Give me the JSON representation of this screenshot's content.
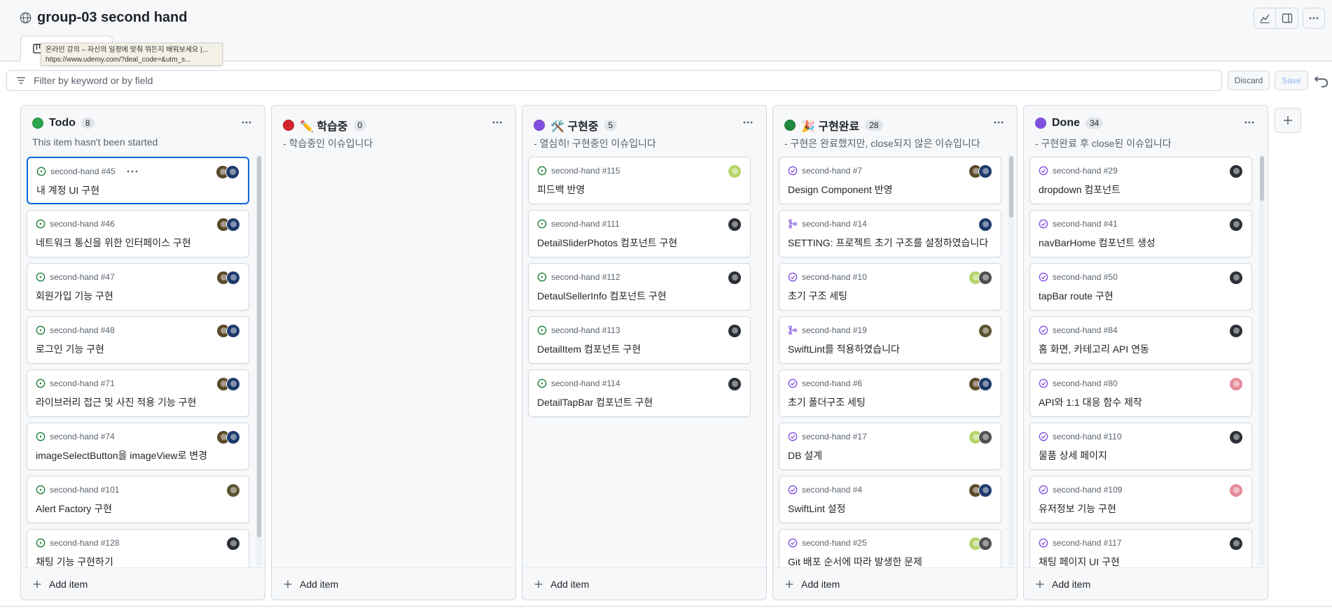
{
  "header": {
    "title": "group-03 second hand",
    "icons": [
      "globe-icon",
      "insights-icon",
      "panel-icon",
      "kebab-icon"
    ]
  },
  "view_tab": {
    "icon": "board-icon"
  },
  "tooltip": {
    "line1": "온라인 강의 – 자신의 일정에 맞춰 뭐든지 배워보세요 |...",
    "line2": "https://www.udemy.com/?deal_code=&utm_s..."
  },
  "filter": {
    "placeholder": "Filter by keyword or by field",
    "discard_label": "Discard",
    "save_label": "Save"
  },
  "colors": {
    "green": "#1f883d",
    "red": "#cf222e",
    "purple": "#8250df",
    "blue": "#0969da",
    "open": "#1a7f37",
    "done": "#8250df"
  },
  "columns": [
    {
      "name": "Todo",
      "count": "8",
      "dot": "#2da44e",
      "description": "This item hasn't been started",
      "add_label": "Add item",
      "scroll": {
        "thumb_top": 0,
        "thumb_frac": 0.93
      },
      "cards": [
        {
          "repo": "second-hand #45",
          "title": "내 계정 UI 구현",
          "state": "open",
          "selected": true,
          "avatars": [
            "#5a4a2a",
            "#1e3a6b"
          ]
        },
        {
          "repo": "second-hand #46",
          "title": "네트워크 통신을 위한 인터페이스 구현",
          "state": "open",
          "avatars": [
            "#5a4a2a",
            "#1e3a6b"
          ]
        },
        {
          "repo": "second-hand #47",
          "title": "회원가입 기능 구현",
          "state": "open",
          "avatars": [
            "#5a4a2a",
            "#1e3a6b"
          ]
        },
        {
          "repo": "second-hand #48",
          "title": "로그인 기능 구현",
          "state": "open",
          "avatars": [
            "#5a4a2a",
            "#1e3a6b"
          ]
        },
        {
          "repo": "second-hand #71",
          "title": "라이브러리 접근 및 사진 적용 기능 구현",
          "state": "open",
          "avatars": [
            "#5a4a2a",
            "#1e3a6b"
          ]
        },
        {
          "repo": "second-hand #74",
          "title": "imageSelectButton을 imageView로 변경",
          "state": "open",
          "avatars": [
            "#5a4a2a",
            "#1e3a6b"
          ]
        },
        {
          "repo": "second-hand #101",
          "title": "Alert Factory 구현",
          "state": "open",
          "avatars": [
            "#5b5432"
          ]
        },
        {
          "repo": "second-hand #128",
          "title": "채팅 기능 구현하기",
          "state": "open",
          "avatars": [
            "#2b2f36"
          ]
        }
      ]
    },
    {
      "name": "✏️ 학습중",
      "count": "0",
      "dot": "#d1242f",
      "description": "- 학습중인 이슈입니다",
      "add_label": "Add item",
      "cards": []
    },
    {
      "name": "🛠️ 구현중",
      "count": "5",
      "dot": "#8250df",
      "description": "- 열심히! 구현중인 이슈입니다",
      "add_label": "Add item",
      "cards": [
        {
          "repo": "second-hand #115",
          "title": "피드백 반영",
          "state": "open",
          "avatars": [
            "#b6d46a"
          ]
        },
        {
          "repo": "second-hand #111",
          "title": "DetailSliderPhotos 컴포넌트 구현",
          "state": "open",
          "avatars": [
            "#2b2f36"
          ]
        },
        {
          "repo": "second-hand #112",
          "title": "DetaulSellerInfo 컴포넌트 구현",
          "state": "open",
          "avatars": [
            "#2b2f36"
          ]
        },
        {
          "repo": "second-hand #113",
          "title": "DetailItem 컴포넌트 구현",
          "state": "open",
          "avatars": [
            "#2b2f36"
          ]
        },
        {
          "repo": "second-hand #114",
          "title": "DetailTapBar 컴포넌트 구현",
          "state": "open",
          "avatars": [
            "#2b2f36"
          ]
        }
      ]
    },
    {
      "name": "🎉 구현완료",
      "count": "28",
      "dot": "#1f883d",
      "description": "- 구현은 완료했지만, close되지 않은 이슈입니다",
      "add_label": "Add item",
      "scroll": {
        "thumb_top": 0,
        "thumb_frac": 0.15
      },
      "cards": [
        {
          "repo": "second-hand #7",
          "title": "Design Component 반영",
          "state": "done",
          "avatars": [
            "#5a4a2a",
            "#1e3a6b"
          ]
        },
        {
          "repo": "second-hand #14",
          "title": "SETTING: 프로젝트 초기 구조를 설정하였습니다",
          "state": "merged",
          "avatars": [
            "#1e3a6b"
          ]
        },
        {
          "repo": "second-hand #10",
          "title": "초기 구조 세팅",
          "state": "done",
          "avatars": [
            "#b6d46a",
            "#505050"
          ]
        },
        {
          "repo": "second-hand #19",
          "title": "SwiftLint를 적용하였습니다",
          "state": "merged",
          "avatars": [
            "#5b5432"
          ]
        },
        {
          "repo": "second-hand #6",
          "title": "초기 폴더구조 세팅",
          "state": "done",
          "avatars": [
            "#5a4a2a",
            "#1e3a6b"
          ]
        },
        {
          "repo": "second-hand #17",
          "title": "DB 설계",
          "state": "done",
          "avatars": [
            "#b6d46a",
            "#505050"
          ]
        },
        {
          "repo": "second-hand #4",
          "title": "SwiftLint 설정",
          "state": "done",
          "avatars": [
            "#5a4a2a",
            "#1e3a6b"
          ]
        },
        {
          "repo": "second-hand #25",
          "title": "Git 배포 순서에 따라 발생한 문제",
          "state": "done",
          "avatars": [
            "#b6d46a",
            "#505050"
          ]
        }
      ]
    },
    {
      "name": "Done",
      "count": "34",
      "dot": "#8250df",
      "description": "- 구현완료 후 close된 이슈입니다",
      "add_label": "Add item",
      "scroll": {
        "thumb_top": 0,
        "thumb_frac": 0.11
      },
      "cards": [
        {
          "repo": "second-hand #29",
          "title": "dropdown 컴포넌트",
          "state": "done",
          "avatars": [
            "#2b2f36"
          ]
        },
        {
          "repo": "second-hand #41",
          "title": "navBarHome 컴포넌트 생성",
          "state": "done",
          "avatars": [
            "#2b2f36"
          ]
        },
        {
          "repo": "second-hand #50",
          "title": "tapBar route 구현",
          "state": "done",
          "avatars": [
            "#2b2f36"
          ]
        },
        {
          "repo": "second-hand #84",
          "title": "홈 화면, 카테고리 API 연동",
          "state": "done",
          "avatars": [
            "#2b2f36"
          ]
        },
        {
          "repo": "second-hand #80",
          "title": "API와 1:1 대응 함수 제작",
          "state": "done",
          "avatars": [
            "#e58a9a"
          ]
        },
        {
          "repo": "second-hand #110",
          "title": "물품 상세 페이지",
          "state": "done",
          "avatars": [
            "#2b2f36"
          ]
        },
        {
          "repo": "second-hand #109",
          "title": "유저정보 기능 구현",
          "state": "done",
          "avatars": [
            "#e58a9a"
          ]
        },
        {
          "repo": "second-hand #117",
          "title": "채팅 페이지 UI 구현",
          "state": "done",
          "avatars": [
            "#2b2f36"
          ]
        }
      ]
    }
  ]
}
